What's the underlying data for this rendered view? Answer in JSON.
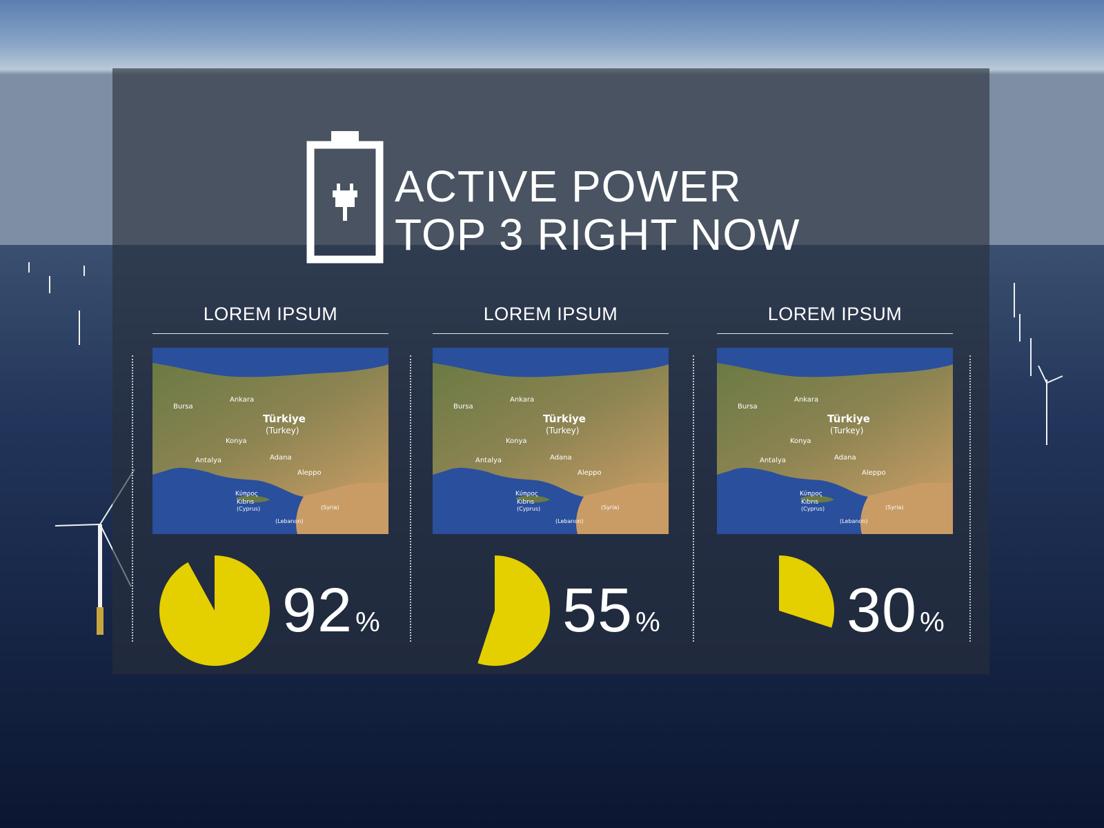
{
  "title": {
    "line1": "ACTIVE POWER",
    "line2": "TOP 3 RIGHT NOW"
  },
  "icons": {
    "battery": "battery-charging-icon"
  },
  "colors": {
    "accent": "#e4cf00",
    "panel": "#2a303c"
  },
  "columns": [
    {
      "header": "LOREM IPSUM",
      "percent": "92",
      "percent_sign": "%",
      "map_labels": {
        "country": "Türkiye",
        "country_alt": "(Turkey)",
        "city1": "Ankara",
        "city2": "Bursa",
        "city3": "Konya",
        "city4": "Antalya",
        "city5": "Adana",
        "city6": "Aleppo",
        "island1": "Κύπρος",
        "island2": "Kıbrıs",
        "island3": "(Cyprus)",
        "region1": "(Syria)",
        "region2": "(Lebanon)"
      }
    },
    {
      "header": "LOREM IPSUM",
      "percent": "55",
      "percent_sign": "%",
      "map_labels": {
        "country": "Türkiye",
        "country_alt": "(Turkey)",
        "city1": "Ankara",
        "city2": "Bursa",
        "city3": "Konya",
        "city4": "Antalya",
        "city5": "Adana",
        "city6": "Aleppo",
        "island1": "Κύπρος",
        "island2": "Kıbrıs",
        "island3": "(Cyprus)",
        "region1": "(Syria)",
        "region2": "(Lebanon)"
      }
    },
    {
      "header": "LOREM IPSUM",
      "percent": "30",
      "percent_sign": "%",
      "map_labels": {
        "country": "Türkiye",
        "country_alt": "(Turkey)",
        "city1": "Ankara",
        "city2": "Bursa",
        "city3": "Konya",
        "city4": "Antalya",
        "city5": "Adana",
        "city6": "Aleppo",
        "island1": "Κύπρος",
        "island2": "Kıbrıs",
        "island3": "(Cyprus)",
        "region1": "(Syria)",
        "region2": "(Lebanon)"
      }
    }
  ],
  "chart_data": {
    "type": "pie",
    "categories": [
      "LOREM IPSUM",
      "LOREM IPSUM",
      "LOREM IPSUM"
    ],
    "values": [
      92,
      55,
      30
    ],
    "unit": "%",
    "title": "ACTIVE POWER TOP 3 RIGHT NOW"
  }
}
